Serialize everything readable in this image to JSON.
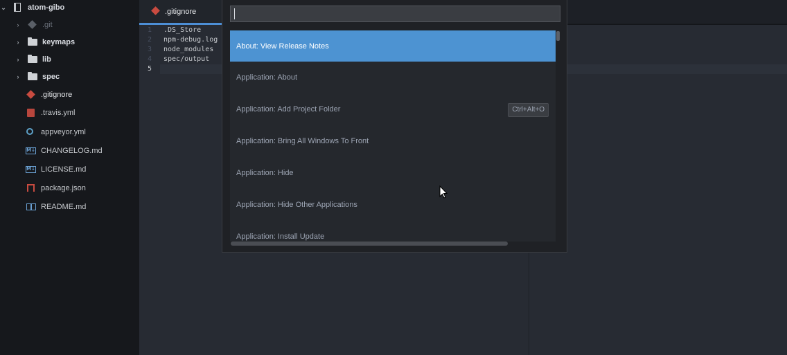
{
  "tree": {
    "project": "atom-gibo",
    "items": [
      {
        "name": ".git",
        "type": "folder-git"
      },
      {
        "name": "keymaps",
        "type": "folder"
      },
      {
        "name": "lib",
        "type": "folder"
      },
      {
        "name": "spec",
        "type": "folder"
      },
      {
        "name": ".gitignore",
        "type": "git-file"
      },
      {
        "name": ".travis.yml",
        "type": "travis-file"
      },
      {
        "name": "appveyor.yml",
        "type": "appveyor-file"
      },
      {
        "name": "CHANGELOG.md",
        "type": "markdown-file"
      },
      {
        "name": "LICENSE.md",
        "type": "markdown-file"
      },
      {
        "name": "package.json",
        "type": "npm-file"
      },
      {
        "name": "README.md",
        "type": "book-file"
      }
    ]
  },
  "tab": {
    "label": ".gitignore"
  },
  "editor": {
    "line_numbers": [
      "1",
      "2",
      "3",
      "4",
      "5"
    ],
    "lines": [
      ".DS_Store",
      "npm-debug.log",
      "node_modules",
      "spec/output",
      ""
    ]
  },
  "palette": {
    "query": "",
    "items": [
      {
        "label": "About: View Release Notes",
        "shortcut": ""
      },
      {
        "label": "Application: About",
        "shortcut": ""
      },
      {
        "label": "Application: Add Project Folder",
        "shortcut": "Ctrl+Alt+O"
      },
      {
        "label": "Application: Bring All Windows To Front",
        "shortcut": ""
      },
      {
        "label": "Application: Hide",
        "shortcut": ""
      },
      {
        "label": "Application: Hide Other Applications",
        "shortcut": ""
      },
      {
        "label": "Application: Install Update",
        "shortcut": ""
      }
    ]
  },
  "colors": {
    "accent": "#4d93d2",
    "git": "#c94b40"
  }
}
